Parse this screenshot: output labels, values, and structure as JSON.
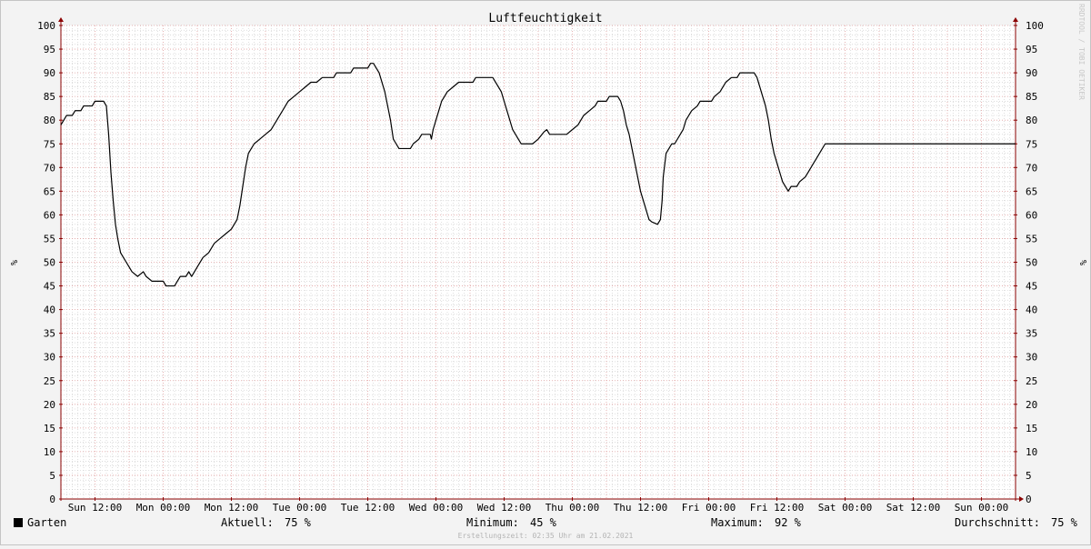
{
  "chart_data": {
    "type": "line",
    "title": "Luftfeuchtigkeit",
    "ylabel": "%",
    "watermark": "RRDTOOL / TOBI OETIKER",
    "ylim": [
      0,
      100
    ],
    "y_ticks": [
      0,
      5,
      10,
      15,
      20,
      25,
      30,
      35,
      40,
      45,
      50,
      55,
      60,
      65,
      70,
      75,
      80,
      85,
      90,
      95,
      100
    ],
    "x_unit": "hours",
    "xlim": [
      0,
      168
    ],
    "x_ticks": [
      {
        "label": "Sun 12:00",
        "hours": 6
      },
      {
        "label": "Mon 00:00",
        "hours": 18
      },
      {
        "label": "Mon 12:00",
        "hours": 30
      },
      {
        "label": "Tue 00:00",
        "hours": 42
      },
      {
        "label": "Tue 12:00",
        "hours": 54
      },
      {
        "label": "Wed 00:00",
        "hours": 66
      },
      {
        "label": "Wed 12:00",
        "hours": 78
      },
      {
        "label": "Thu 00:00",
        "hours": 90
      },
      {
        "label": "Thu 12:00",
        "hours": 102
      },
      {
        "label": "Fri 00:00",
        "hours": 114
      },
      {
        "label": "Fri 12:00",
        "hours": 126
      },
      {
        "label": "Sat 00:00",
        "hours": 138
      },
      {
        "label": "Sat 12:00",
        "hours": 150
      },
      {
        "label": "Sun 00:00",
        "hours": 162
      }
    ],
    "grid": true,
    "series": [
      {
        "name": "Garten",
        "color": "#000000",
        "points": [
          [
            0,
            79
          ],
          [
            0.5,
            80
          ],
          [
            1,
            81
          ],
          [
            2,
            81
          ],
          [
            2.5,
            82
          ],
          [
            3.5,
            82
          ],
          [
            4,
            83
          ],
          [
            5.5,
            83
          ],
          [
            6,
            84
          ],
          [
            7.5,
            84
          ],
          [
            8,
            83
          ],
          [
            8.4,
            77
          ],
          [
            8.8,
            69
          ],
          [
            9.2,
            63
          ],
          [
            9.6,
            58
          ],
          [
            10,
            55
          ],
          [
            10.5,
            52
          ],
          [
            11,
            51
          ],
          [
            11.5,
            50
          ],
          [
            12,
            49
          ],
          [
            12.5,
            48
          ],
          [
            13.5,
            47
          ],
          [
            14.5,
            48
          ],
          [
            15,
            47
          ],
          [
            16,
            46
          ],
          [
            18,
            46
          ],
          [
            18.5,
            45
          ],
          [
            20,
            45
          ],
          [
            20.5,
            46
          ],
          [
            21,
            47
          ],
          [
            22,
            47
          ],
          [
            22.5,
            48
          ],
          [
            23,
            47
          ],
          [
            24,
            49
          ],
          [
            25,
            51
          ],
          [
            26,
            52
          ],
          [
            27,
            54
          ],
          [
            28,
            55
          ],
          [
            29,
            56
          ],
          [
            30,
            57
          ],
          [
            31,
            59
          ],
          [
            31.5,
            62
          ],
          [
            32,
            66
          ],
          [
            32.5,
            70
          ],
          [
            33,
            73
          ],
          [
            34,
            75
          ],
          [
            35,
            76
          ],
          [
            36,
            77
          ],
          [
            37,
            78
          ],
          [
            38,
            80
          ],
          [
            39,
            82
          ],
          [
            40,
            84
          ],
          [
            41,
            85
          ],
          [
            42,
            86
          ],
          [
            43,
            87
          ],
          [
            44,
            88
          ],
          [
            45,
            88
          ],
          [
            46,
            89
          ],
          [
            48,
            89
          ],
          [
            48.5,
            90
          ],
          [
            51,
            90
          ],
          [
            51.5,
            91
          ],
          [
            54,
            91
          ],
          [
            54.5,
            92
          ],
          [
            55,
            92
          ],
          [
            55.5,
            91
          ],
          [
            56,
            90
          ],
          [
            56.5,
            88
          ],
          [
            57,
            86
          ],
          [
            57.5,
            83
          ],
          [
            58,
            80
          ],
          [
            58.5,
            76
          ],
          [
            59,
            75
          ],
          [
            59.5,
            74
          ],
          [
            61.5,
            74
          ],
          [
            62,
            75
          ],
          [
            63,
            76
          ],
          [
            63.5,
            77
          ],
          [
            65,
            77
          ],
          [
            65.2,
            76
          ],
          [
            65.5,
            78
          ],
          [
            66,
            80
          ],
          [
            66.5,
            82
          ],
          [
            67,
            84
          ],
          [
            67.5,
            85
          ],
          [
            68,
            86
          ],
          [
            69,
            87
          ],
          [
            70,
            88
          ],
          [
            72.5,
            88
          ],
          [
            73,
            89
          ],
          [
            76,
            89
          ],
          [
            76.5,
            88
          ],
          [
            77,
            87
          ],
          [
            77.5,
            86
          ],
          [
            78,
            84
          ],
          [
            78.5,
            82
          ],
          [
            79,
            80
          ],
          [
            79.5,
            78
          ],
          [
            80,
            77
          ],
          [
            80.5,
            76
          ],
          [
            81,
            75
          ],
          [
            83,
            75
          ],
          [
            84,
            76
          ],
          [
            85,
            77.5
          ],
          [
            85.5,
            78
          ],
          [
            86,
            77
          ],
          [
            89,
            77
          ],
          [
            90,
            78
          ],
          [
            91,
            79
          ],
          [
            91.5,
            80
          ],
          [
            92,
            81
          ],
          [
            93,
            82
          ],
          [
            94,
            83
          ],
          [
            94.5,
            84
          ],
          [
            96,
            84
          ],
          [
            96.5,
            85
          ],
          [
            98,
            85
          ],
          [
            98.5,
            84
          ],
          [
            99,
            82
          ],
          [
            99.5,
            79
          ],
          [
            100,
            77
          ],
          [
            100.5,
            74
          ],
          [
            101,
            71
          ],
          [
            101.5,
            68
          ],
          [
            102,
            65
          ],
          [
            102.5,
            63
          ],
          [
            103,
            61
          ],
          [
            103.5,
            59
          ],
          [
            104,
            58.5
          ],
          [
            105,
            58
          ],
          [
            105.5,
            59
          ],
          [
            105.8,
            63
          ],
          [
            106,
            68
          ],
          [
            106.5,
            73
          ],
          [
            107,
            74
          ],
          [
            107.5,
            75
          ],
          [
            108,
            75
          ],
          [
            109,
            77
          ],
          [
            109.5,
            78
          ],
          [
            110,
            80
          ],
          [
            110.5,
            81
          ],
          [
            111,
            82
          ],
          [
            112,
            83
          ],
          [
            112.5,
            84
          ],
          [
            114.5,
            84
          ],
          [
            115,
            85
          ],
          [
            116,
            86
          ],
          [
            116.5,
            87
          ],
          [
            117,
            88
          ],
          [
            118,
            89
          ],
          [
            119,
            89
          ],
          [
            119.5,
            90
          ],
          [
            122,
            90
          ],
          [
            122.5,
            89
          ],
          [
            123,
            87
          ],
          [
            123.5,
            85
          ],
          [
            124,
            83
          ],
          [
            124.5,
            80
          ],
          [
            125,
            76
          ],
          [
            125.5,
            73
          ],
          [
            126,
            71
          ],
          [
            126.5,
            69
          ],
          [
            127,
            67
          ],
          [
            127.5,
            66
          ],
          [
            128,
            65
          ],
          [
            128.5,
            66
          ],
          [
            129.5,
            66
          ],
          [
            130,
            67
          ],
          [
            131,
            68
          ],
          [
            131.5,
            69
          ],
          [
            132,
            70
          ],
          [
            132.5,
            71
          ],
          [
            133,
            72
          ],
          [
            133.5,
            73
          ],
          [
            134,
            74
          ],
          [
            134.5,
            75
          ],
          [
            168,
            75
          ]
        ]
      }
    ],
    "legend": [
      {
        "label": "Garten",
        "color": "#000000"
      }
    ],
    "stats": {
      "current_label": "Aktuell:",
      "current_value": "75 %",
      "min_label": "Minimum:",
      "min_value": "45 %",
      "max_label": "Maximum:",
      "max_value": "92 %",
      "avg_label": "Durchschnitt:",
      "avg_value": "75 %"
    },
    "footer": "Erstellungszeit: 02:35 Uhr am 21.02.2021",
    "colors": {
      "background": "#f3f3f3",
      "plot_background": "#ffffff",
      "minor_grid": "#c8c8c8",
      "major_grid": "#e0a0a0",
      "axis": "#8b0000",
      "text": "#000000",
      "footer_text": "#b4b4b4"
    }
  }
}
